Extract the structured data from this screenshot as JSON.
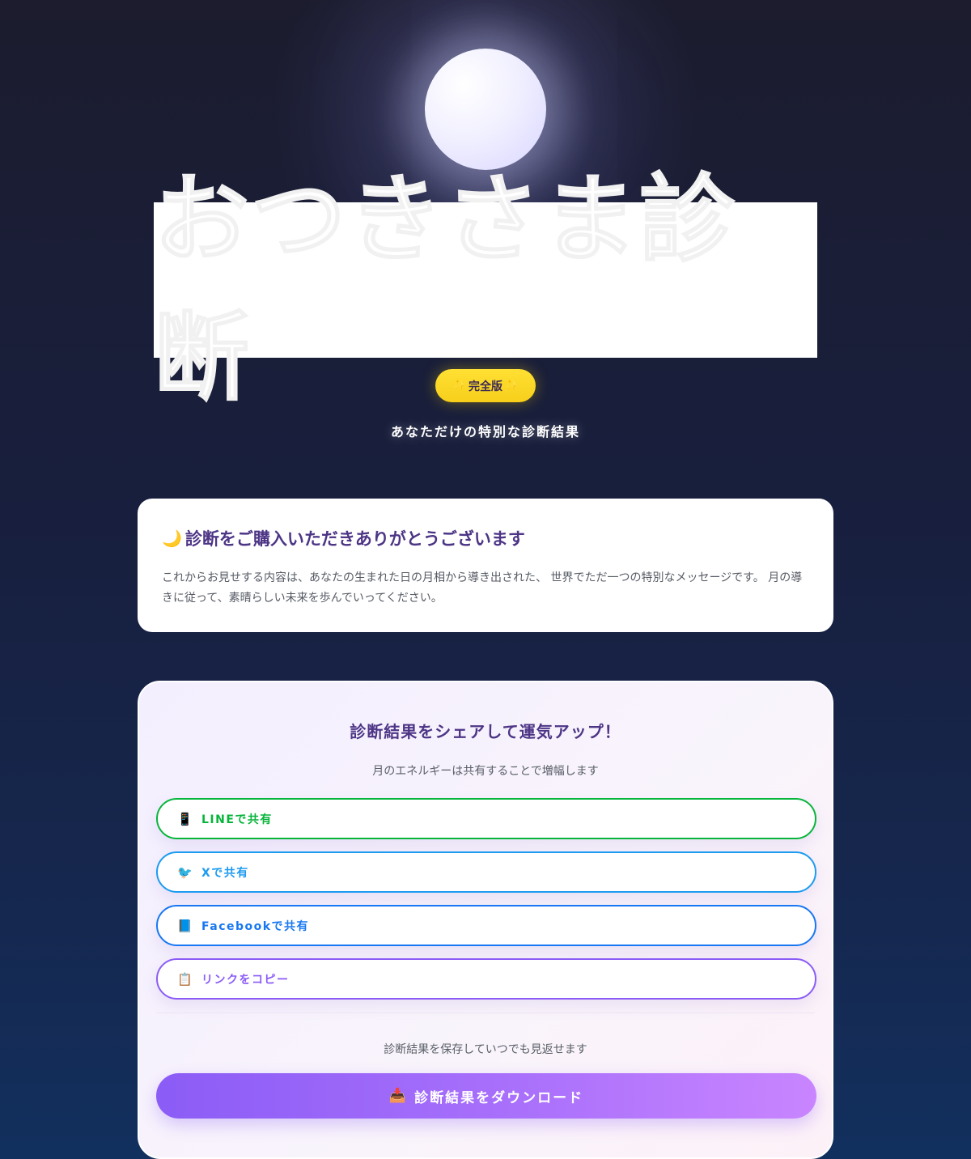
{
  "hero": {
    "title": "おつきさま診断",
    "badge_label": "完全版",
    "badge_spark": "✨",
    "subtitle": "あなただけの特別な診断結果"
  },
  "thanks": {
    "icon": "🌙",
    "title": "診断をご購入いただきありがとうございます",
    "body": "これからお見せする内容は、あなたの生まれた日の月相から導き出された、 世界でただ一つの特別なメッセージです。 月の導きに従って、素晴らしい未来を歩んでいってください。"
  },
  "share": {
    "title": "診断結果をシェアして運気アップ！",
    "subtitle": "月のエネルギーは共有することで増幅します",
    "buttons": [
      {
        "icon": "📱",
        "label": "LINEで共有",
        "color": "#07b53b"
      },
      {
        "icon": "🐦",
        "label": "Xで共有",
        "color": "#1d9bf0"
      },
      {
        "icon": "📘",
        "label": "Facebookで共有",
        "color": "#1877f2"
      },
      {
        "icon": "📋",
        "label": "リンクをコピー",
        "color": "#8b5cf6"
      }
    ],
    "save_text": "診断結果を保存していつでも見返せます",
    "download_icon": "📥",
    "download_label": "診断結果をダウンロード"
  }
}
